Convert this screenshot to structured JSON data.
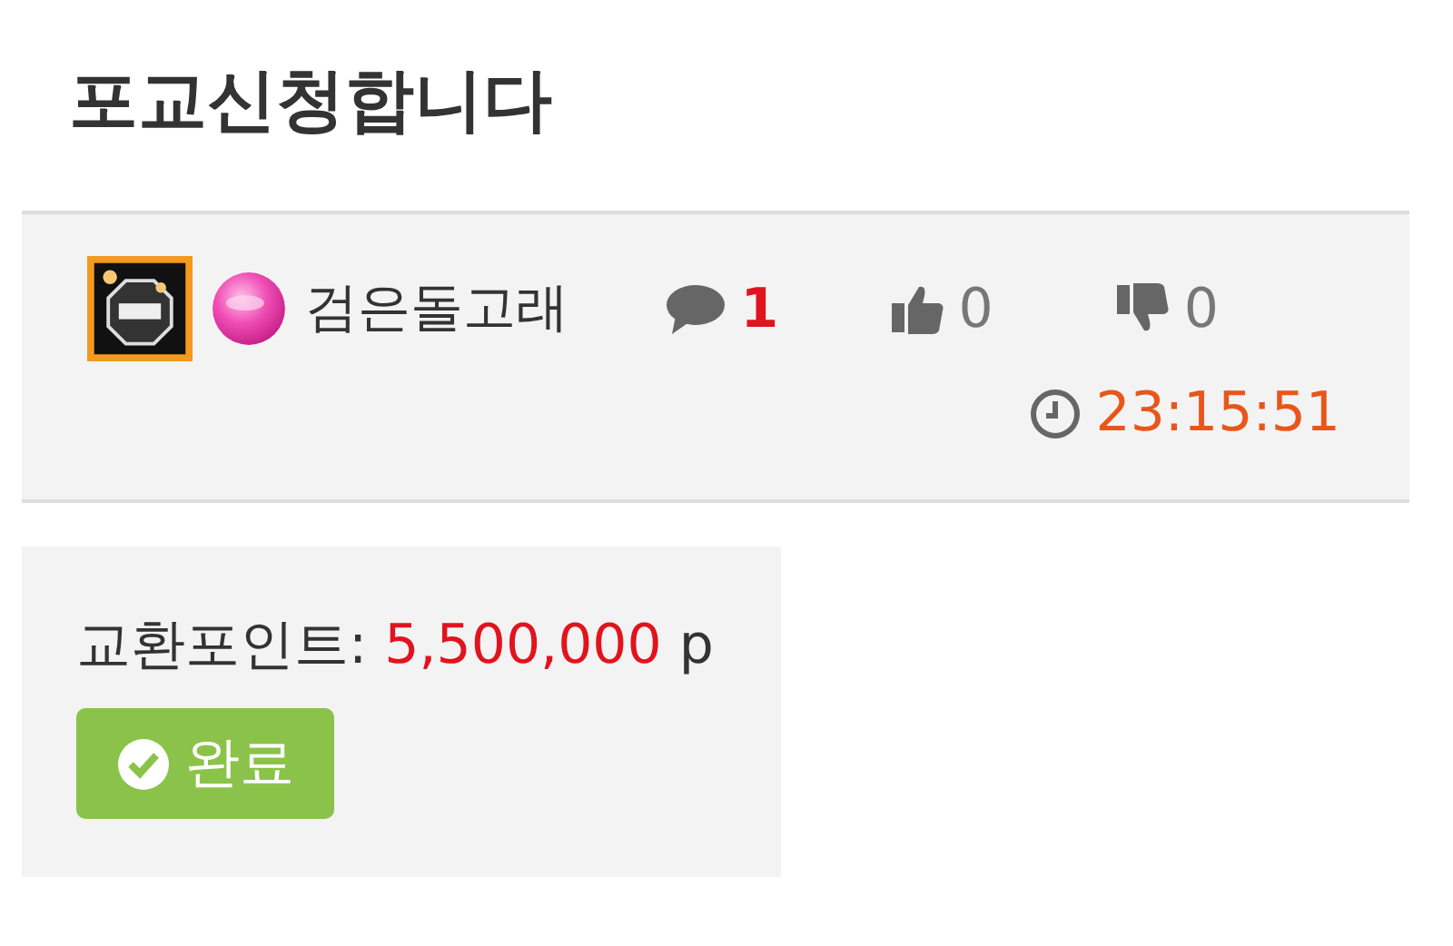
{
  "title": "포교신청합니다",
  "author": {
    "name": "검은돌고래"
  },
  "stats": {
    "comments": "1",
    "likes": "0",
    "dislikes": "0",
    "time": "23:15:51"
  },
  "exchange": {
    "label": "교환포인트:",
    "value": "5,500,000",
    "unit": "p"
  },
  "status_button": {
    "label": "완료"
  }
}
